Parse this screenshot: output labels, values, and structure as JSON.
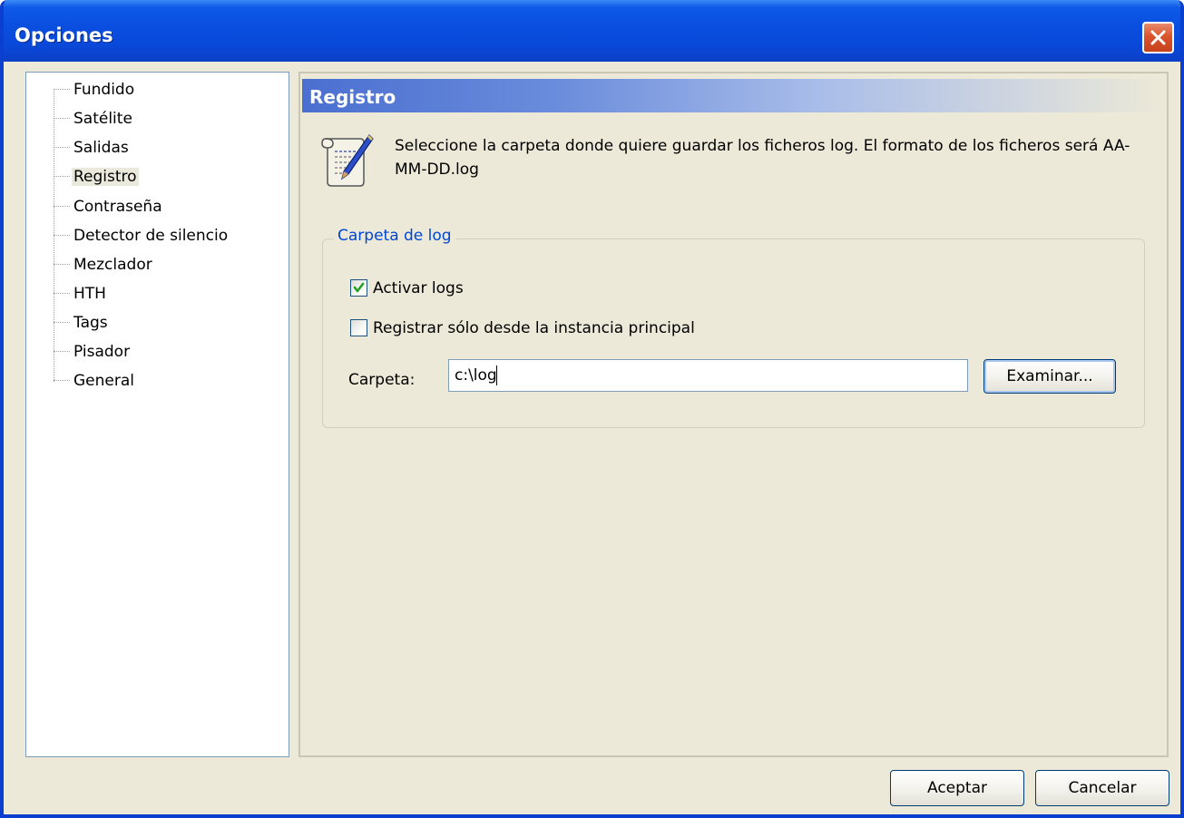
{
  "window": {
    "title": "Opciones"
  },
  "tree": {
    "items": [
      {
        "label": "Fundido"
      },
      {
        "label": "Satélite"
      },
      {
        "label": "Salidas"
      },
      {
        "label": "Registro",
        "selected": true
      },
      {
        "label": "Contraseña"
      },
      {
        "label": "Detector de silencio"
      },
      {
        "label": "Mezclador"
      },
      {
        "label": "HTH"
      },
      {
        "label": "Tags"
      },
      {
        "label": "Pisador"
      },
      {
        "label": "General"
      }
    ]
  },
  "panel": {
    "header": "Registro",
    "icon": "scroll-quill-icon",
    "description": "Seleccione la carpeta donde quiere guardar los ficheros log. El formato de los ficheros será AA-MM-DD.log",
    "group": {
      "legend": "Carpeta de log",
      "activate_logs": {
        "label": "Activar logs",
        "checked": true
      },
      "main_instance_only": {
        "label": "Registrar sólo desde la instancia principal",
        "checked": false
      },
      "folder_label": "Carpeta:",
      "folder_value": "c:\\log",
      "browse_label": "Examinar..."
    }
  },
  "footer": {
    "ok_label": "Aceptar",
    "cancel_label": "Cancelar"
  },
  "colors": {
    "titlebar": "#0a4fe0",
    "accent_legend": "#0046d5",
    "checkmark": "#21a121",
    "close_button": "#d9542b"
  }
}
